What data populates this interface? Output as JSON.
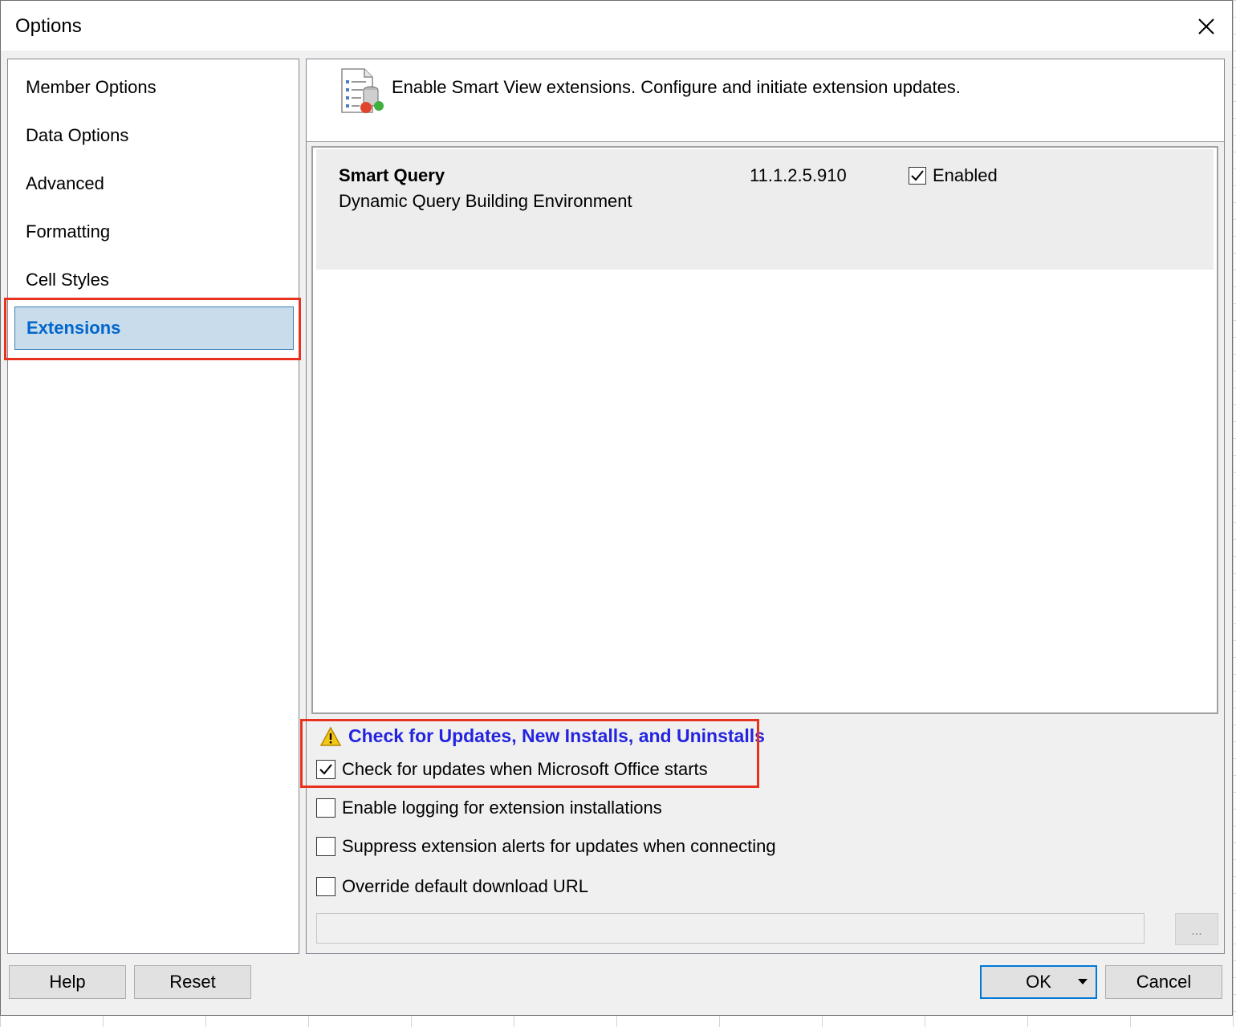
{
  "window": {
    "title": "Options"
  },
  "nav": {
    "items": [
      {
        "label": "Member Options"
      },
      {
        "label": "Data Options"
      },
      {
        "label": "Advanced"
      },
      {
        "label": "Formatting"
      },
      {
        "label": "Cell Styles"
      },
      {
        "label": "Extensions",
        "selected": true
      }
    ]
  },
  "header": {
    "description": "Enable Smart View extensions. Configure and initiate extension updates."
  },
  "extensions": [
    {
      "name": "Smart Query",
      "description": "Dynamic Query Building Environment",
      "version": "11.1.2.5.910",
      "enabled_label": "Enabled",
      "enabled": true
    }
  ],
  "updates": {
    "link_label": "Check for Updates, New Installs, and Uninstalls",
    "options": [
      {
        "label": "Check for updates when Microsoft Office starts",
        "checked": true
      },
      {
        "label": "Enable logging for extension installations",
        "checked": false
      },
      {
        "label": "Suppress extension alerts for updates when connecting",
        "checked": false
      },
      {
        "label": "Override default download URL",
        "checked": false
      }
    ],
    "url_value": "",
    "browse_label": "..."
  },
  "buttons": {
    "help": "Help",
    "reset": "Reset",
    "ok": "OK",
    "cancel": "Cancel"
  },
  "colors": {
    "highlight": "#e8321f",
    "selection": "#c9dcec",
    "link": "#2424e0",
    "focus": "#0078d7"
  }
}
